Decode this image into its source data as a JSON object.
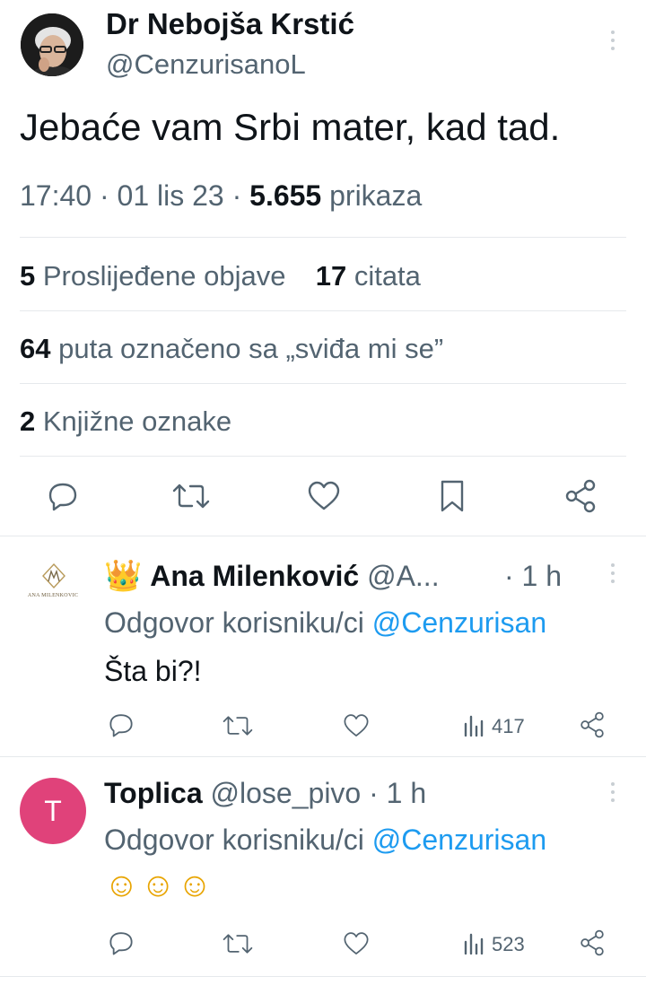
{
  "tweet": {
    "author_name": "Dr Nebojša Krstić",
    "author_handle": "@CenzurisanoL",
    "text": "Jebaće vam Srbi mater, kad tad.",
    "time": "17:40",
    "date": "01 lis 23",
    "views_count": "5.655",
    "views_label": "prikaza",
    "reposts_count": "5",
    "reposts_label": "Proslijeđene objave",
    "quotes_count": "17",
    "quotes_label": "citata",
    "likes_count": "64",
    "likes_label": "puta označeno sa „sviđa mi se”",
    "bookmarks_count": "2",
    "bookmarks_label": "Knjižne oznake"
  },
  "replies": [
    {
      "emoji": "👑",
      "author_name": "Ana Milenković",
      "author_handle": "@A...",
      "time": "· 1 h",
      "reply_prefix": "Odgovor korisniku/ci",
      "reply_to": "@Cenzurisan",
      "text": "Šta bi?!",
      "views": "417",
      "avatar_logo_text": "ANA MILENKOVIC"
    },
    {
      "author_name": "Toplica",
      "author_handle": "@lose_pivo",
      "time": "· 1 h",
      "reply_prefix": "Odgovor korisniku/ci",
      "reply_to": "@Cenzurisan",
      "text": "☺☺☺",
      "views": "523",
      "avatar_letter": "T"
    }
  ],
  "colors": {
    "accent": "#1d9bf0",
    "avatar_pink": "#e0427a",
    "text_secondary": "#536471"
  }
}
